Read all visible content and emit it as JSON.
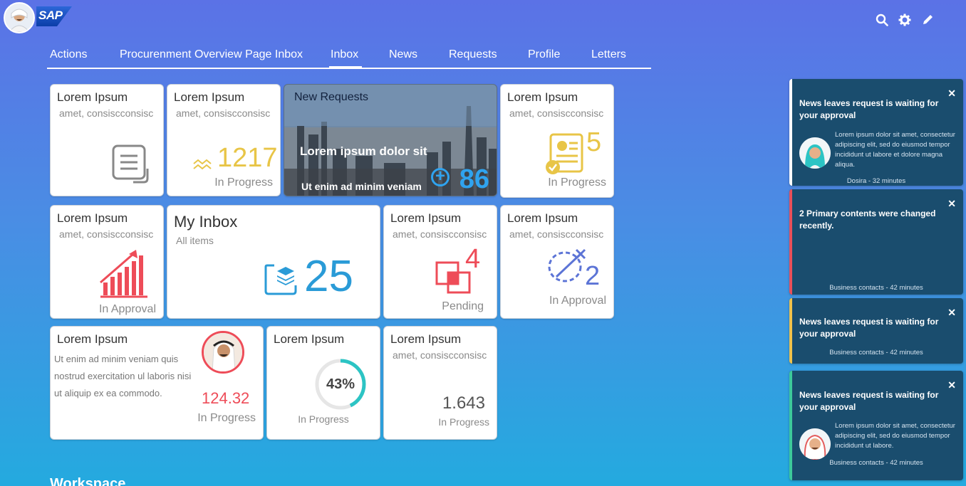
{
  "header": {
    "logo_text": "SAP",
    "icons": [
      "search-icon",
      "gear-icon",
      "pencil-icon"
    ]
  },
  "tabs": [
    {
      "label": "Actions"
    },
    {
      "label": "Procurenment Overview Page Inbox"
    },
    {
      "label": "Inbox",
      "active": true
    },
    {
      "label": "News"
    },
    {
      "label": "Requests"
    },
    {
      "label": "Profile"
    },
    {
      "label": "Letters"
    }
  ],
  "tiles": {
    "t1": {
      "title": "Lorem Ipsum",
      "sub": "amet, consiscconsisc"
    },
    "t2": {
      "title": "Lorem Ipsum",
      "sub": "amet, consiscconsisc",
      "number": "1217",
      "status": "In Progress"
    },
    "news": {
      "title": "New Requests",
      "main": "Lorem ipsum dolor sit",
      "foot": "Ut enim ad minim veniam",
      "count": "86"
    },
    "t4": {
      "title": "Lorem Ipsum",
      "sub": "amet, consiscconsisc",
      "number": "5",
      "status": "In Progress"
    },
    "t5": {
      "title": "Lorem Ipsum",
      "sub": "amet, consiscconsisc",
      "status": "In Approval"
    },
    "inbox": {
      "title": "My Inbox",
      "sub": "All items",
      "number": "25"
    },
    "t7": {
      "title": "Lorem Ipsum",
      "sub": "amet, consiscconsisc",
      "number": "4",
      "status": "Pending"
    },
    "t8": {
      "title": "Lorem Ipsum",
      "sub": "amet, consiscconsisc",
      "number": "2",
      "status": "In Approval"
    },
    "t9": {
      "title": "Lorem Ipsum",
      "body": "Ut enim ad minim veniam quis nostrud exercitation ul laboris nisi ut aliquip ex ea commodo.",
      "number": "124.32",
      "status": "In Progress"
    },
    "t10": {
      "title": "Lorem Ipsum",
      "percent": 43,
      "percent_label": "43%",
      "status": "In Progress"
    },
    "t11": {
      "title": "Lorem Ipsum",
      "sub": "amet, consiscconsisc",
      "number": "1.643",
      "status": "In Progress"
    }
  },
  "notifications": [
    {
      "title": "News leaves request is waiting for your approval",
      "body": "Lorem ipsum dolor sit amet, consectetur adipiscing elit, sed do eiusmod tempor incididunt ut labore et dolore magna aliqua.",
      "footer": "Dosira - 32 minutes",
      "accent": "#ffffff"
    },
    {
      "title": "2 Primary contents were changed recently.",
      "footer": "Business contacts - 42 minutes",
      "accent": "#e8505b"
    },
    {
      "title": "News leaves request is waiting for your approval",
      "footer": "Business contacts - 42 minutes",
      "accent": "#f0c24b"
    },
    {
      "title": "News leaves request is waiting for your approval",
      "body": "Lorem ipsum dolor sit amet, consectetur adipiscing elit, sed do eiusmod tempor incididunt ut labore.",
      "footer": "Business contacts - 42 minutes",
      "accent": "#3cc99b"
    }
  ],
  "section": {
    "workspace_label": "Workspace"
  },
  "colors": {
    "gold": "#e8c547",
    "red": "#ee4c58",
    "blue": "#2a9bd7",
    "purple": "#5c74d6",
    "teal": "#2cc4c4"
  }
}
